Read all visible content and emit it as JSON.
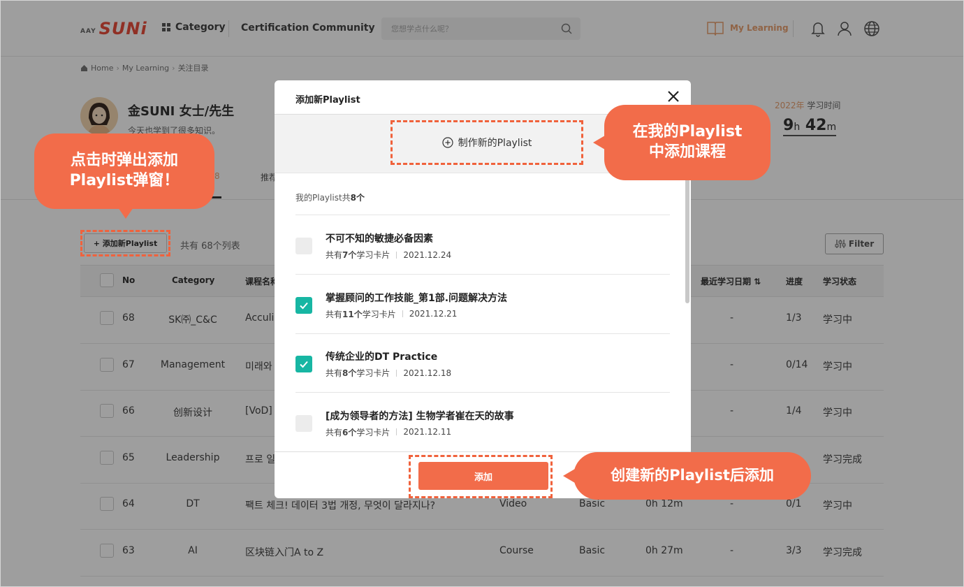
{
  "header": {
    "logo_small": "AAY",
    "logo_main": "SUNi",
    "nav_category": "Category",
    "nav_certification": "Certification",
    "nav_community": "Community",
    "search_placeholder": "您想学点什么呢？",
    "my_learning": "My Learning"
  },
  "breadcrumb": [
    "Home",
    "My Learning",
    "关注目录"
  ],
  "profile": {
    "name": "金SUNI 女士/先生",
    "subtitle": "今天也学到了很多知识。",
    "stat_year": "2022年",
    "stat_label": "学习时间",
    "stat_hours": "9",
    "stat_h_unit": "h",
    "stat_minutes": "42",
    "stat_m_unit": "m"
  },
  "tabs": {
    "fragment_1": "8",
    "fragment_2": "推荐"
  },
  "toolbar": {
    "add_playlist_label": "+ 添加新Playlist",
    "list_count_text": "共有 68个列表",
    "filter_label": "Filter"
  },
  "table": {
    "headers": {
      "no": "No",
      "category": "Category",
      "course": "课程名称",
      "recent": "最近学习日期",
      "progress": "进度",
      "status": "学习状态"
    },
    "rows": [
      {
        "no": "68",
        "category": "SK㈜_C&C",
        "course": "Acculi",
        "type": "",
        "level": "",
        "time": "",
        "recent": "-",
        "progress": "1/3",
        "status": "学习中"
      },
      {
        "no": "67",
        "category": "Management",
        "course": "미래와",
        "type": "",
        "level": "",
        "time": "",
        "recent": "-",
        "progress": "0/14",
        "status": "学习中"
      },
      {
        "no": "66",
        "category": "创新设计",
        "course": "[VoD]",
        "type": "",
        "level": "",
        "time": "",
        "recent": "-",
        "progress": "1/4",
        "status": "学习中"
      },
      {
        "no": "65",
        "category": "Leadership",
        "course": "프로 일",
        "type": "",
        "level": "",
        "time": "",
        "recent": "",
        "progress": "",
        "status": "学习完成"
      },
      {
        "no": "64",
        "category": "DT",
        "course": "팩트 체크! 데이터 3법 개정, 무엇이 달라지나?",
        "type": "Video",
        "level": "Basic",
        "time": "0h 12m",
        "recent": "-",
        "progress": "0/1",
        "status": "学习中"
      },
      {
        "no": "63",
        "category": "AI",
        "course": "区块链入门A to Z",
        "type": "Course",
        "level": "Basic",
        "time": "0h 27m",
        "recent": "-",
        "progress": "3/3",
        "status": "学习完成"
      }
    ]
  },
  "modal": {
    "title": "添加新Playlist",
    "create_label": "制作新的Playlist",
    "count_prefix": "我的Playlist共",
    "count_value": "8个",
    "playlists": [
      {
        "name": "不可不知的敏捷必备因素",
        "cards_prefix": "共有",
        "cards_count": "7个",
        "cards_suffix": "学习卡片",
        "date": "2021.12.24",
        "checked": false
      },
      {
        "name": "掌握顾问的工作技能_第1部.问题解决方法",
        "cards_prefix": "共有",
        "cards_count": "11个",
        "cards_suffix": "学习卡片",
        "date": "2021.12.21",
        "checked": true
      },
      {
        "name": "传统企业的DT Practice",
        "cards_prefix": "共有",
        "cards_count": "8个",
        "cards_suffix": "学习卡片",
        "date": "2021.12.18",
        "checked": true
      },
      {
        "name": "[成为领导者的方法] 生物学者崔在天的故事",
        "cards_prefix": "共有",
        "cards_count": "6个",
        "cards_suffix": "学习卡片",
        "date": "2021.12.11",
        "checked": false
      }
    ],
    "add_label": "添加"
  },
  "callouts": {
    "c1_line1": "点击时弹出添加",
    "c1_line2": "Playlist弹窗！",
    "c2_line1": "在我的Playlist",
    "c2_line2": "中添加课程",
    "c3": "创建新的Playlist后添加"
  },
  "colors": {
    "accent": "#f26c4a",
    "checked": "#17b6a3",
    "brand": "#e94e3c"
  }
}
